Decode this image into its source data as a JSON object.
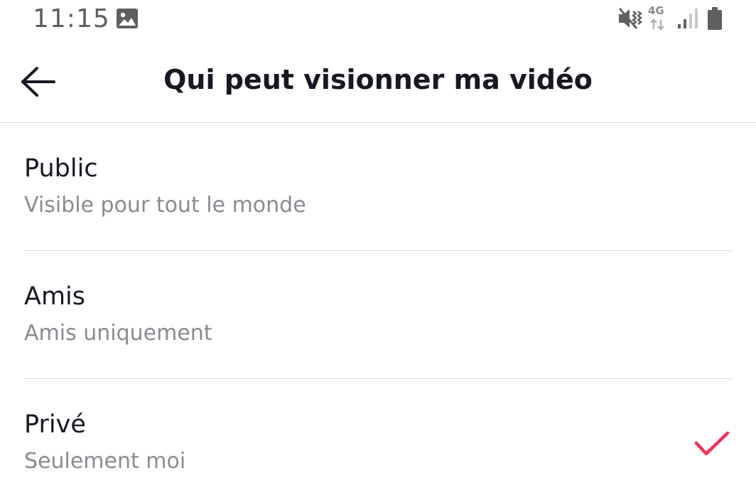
{
  "status_bar": {
    "time": "11:15",
    "network_label": "4G",
    "icons": [
      "image-icon",
      "mute-icon",
      "network-4g-icon",
      "signal-icon",
      "battery-icon"
    ]
  },
  "header": {
    "title": "Qui peut visionner ma vidéo",
    "back_icon": "arrow-left-icon"
  },
  "options": [
    {
      "title": "Public",
      "subtitle": "Visible pour tout le monde",
      "selected": false
    },
    {
      "title": "Amis",
      "subtitle": "Amis uniquement",
      "selected": false
    },
    {
      "title": "Privé",
      "subtitle": "Seulement moi",
      "selected": true
    }
  ],
  "colors": {
    "text_primary": "#161823",
    "text_secondary": "#8a8b91",
    "divider": "#d7d7d9",
    "accent_check": "#fe2c55",
    "status_icons": "#5f5f5f"
  }
}
